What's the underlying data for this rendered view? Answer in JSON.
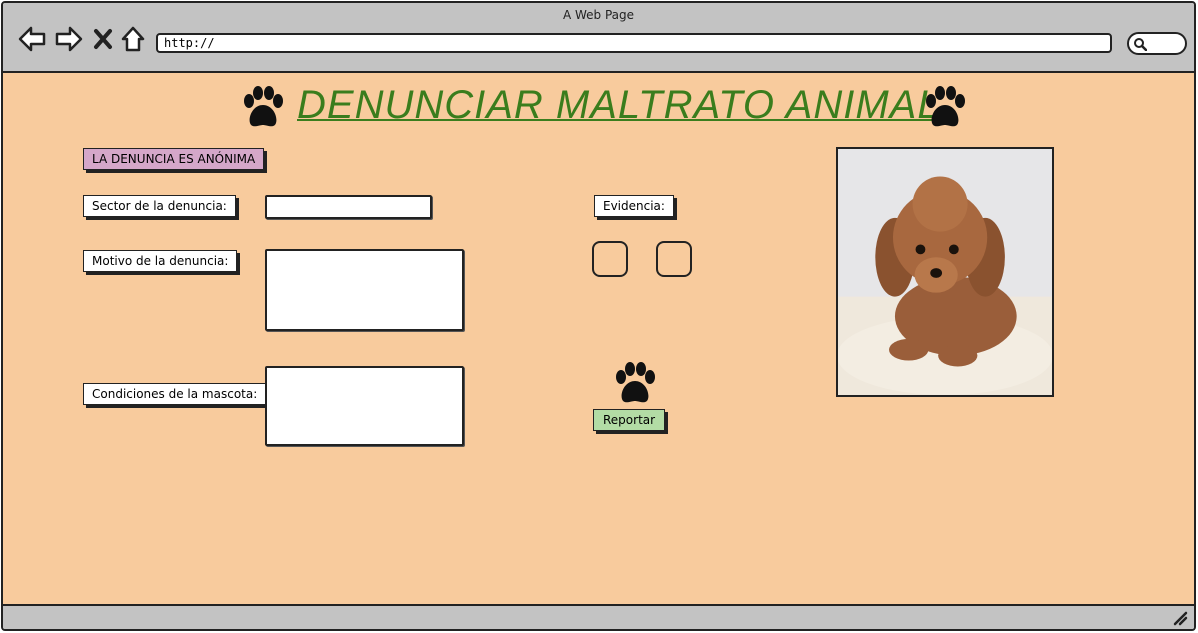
{
  "window": {
    "title": "A Web Page"
  },
  "browser": {
    "url": "http://",
    "nav_icons": [
      "back-arrow-icon",
      "forward-arrow-icon",
      "close-x-icon",
      "home-icon"
    ],
    "search_icon": "search-icon"
  },
  "page": {
    "title": "DENUNCIAR MALTRATO ANIMAL",
    "anon_notice": "LA DENUNCIA ES ANÓNIMA",
    "fields": {
      "sector_label": "Sector de la denuncia:",
      "sector_value": "",
      "motivo_label": "Motivo de la denuncia:",
      "motivo_value": "",
      "condiciones_label": "Condiciones de la mascota:",
      "condiciones_value": ""
    },
    "evidence_label": "Evidencia:",
    "report_button": "Reportar",
    "image_subject": "dog-photo"
  },
  "colors": {
    "background": "#f8cb9d",
    "title": "#3a7d1d",
    "anon_badge": "#d5a7c9",
    "report_button": "#b3dca5",
    "chrome": "#c3c3c3"
  }
}
